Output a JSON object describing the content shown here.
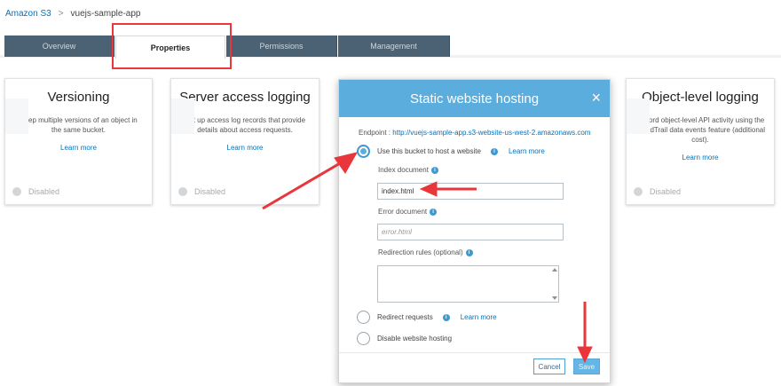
{
  "breadcrumb": {
    "root": "Amazon S3",
    "separator": ">",
    "current": "vuejs-sample-app"
  },
  "tabs": [
    {
      "label": "Overview"
    },
    {
      "label": "Properties"
    },
    {
      "label": "Permissions"
    },
    {
      "label": "Management"
    }
  ],
  "cards": {
    "versioning": {
      "title": "Versioning",
      "desc": "Keep multiple versions of an object in the same bucket.",
      "learn": "Learn more",
      "status": "Disabled"
    },
    "logging": {
      "title": "Server access logging",
      "desc": "Set up access log records that provide details about access requests.",
      "learn": "Learn more",
      "status": "Disabled"
    },
    "object_logging": {
      "title": "Object-level logging",
      "desc": "Record object-level API activity using the CloudTrail data events feature (additional cost).",
      "learn": "Learn more",
      "status": "Disabled"
    }
  },
  "modal": {
    "title": "Static website hosting",
    "close": "×",
    "endpoint_label": "Endpoint :",
    "endpoint_url": "http://vuejs-sample-app.s3-website-us-west-2.amazonaws.com",
    "use_bucket": "Use this bucket to host a website",
    "learn_more": "Learn more",
    "index_label": "Index document",
    "index_value": "index.html",
    "error_label": "Error document",
    "error_placeholder": "error.html",
    "redirect_rules_label": "Redirection rules (optional)",
    "redirect_requests": "Redirect requests",
    "disable_hosting": "Disable website hosting",
    "cancel": "Cancel",
    "save": "Save"
  },
  "info_icon": "i",
  "colors": {
    "tab_bg": "#4a6273",
    "modal_header": "#5aaddd",
    "link": "#0073bb",
    "annotation": "#e8363b"
  }
}
